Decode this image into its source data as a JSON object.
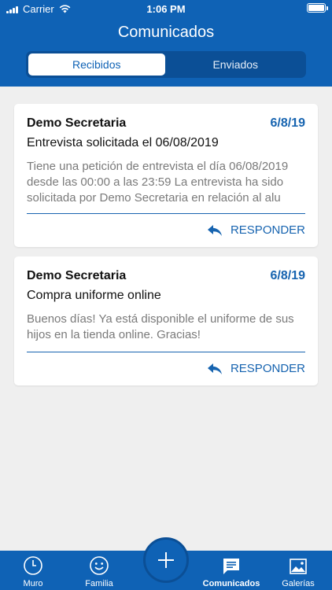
{
  "status_bar": {
    "carrier": "Carrier",
    "time": "1:06 PM"
  },
  "header": {
    "title": "Comunicados"
  },
  "segments": {
    "received": "Recibidos",
    "sent": "Enviados"
  },
  "messages": [
    {
      "sender": "Demo Secretaria",
      "date": "6/8/19",
      "subject": "Entrevista solicitada el 06/08/2019",
      "preview": "Tiene una petición de entrevista el día 06/08/2019 desde las 00:00 a las 23:59 La entrevista ha sido solicitada por Demo Secretaria en relación al alu",
      "reply_label": "RESPONDER"
    },
    {
      "sender": "Demo Secretaria",
      "date": "6/8/19",
      "subject": "Compra uniforme online",
      "preview": "Buenos días! Ya está disponible el uniforme de sus hijos en la tienda online. Gracias!",
      "reply_label": "RESPONDER"
    }
  ],
  "tabbar": {
    "muro": "Muro",
    "familia": "Familia",
    "comunicados": "Comunicados",
    "galerias": "Galerías"
  },
  "colors": {
    "primary": "#0f62b5",
    "accent": "#1764b0",
    "background": "#efefef"
  }
}
